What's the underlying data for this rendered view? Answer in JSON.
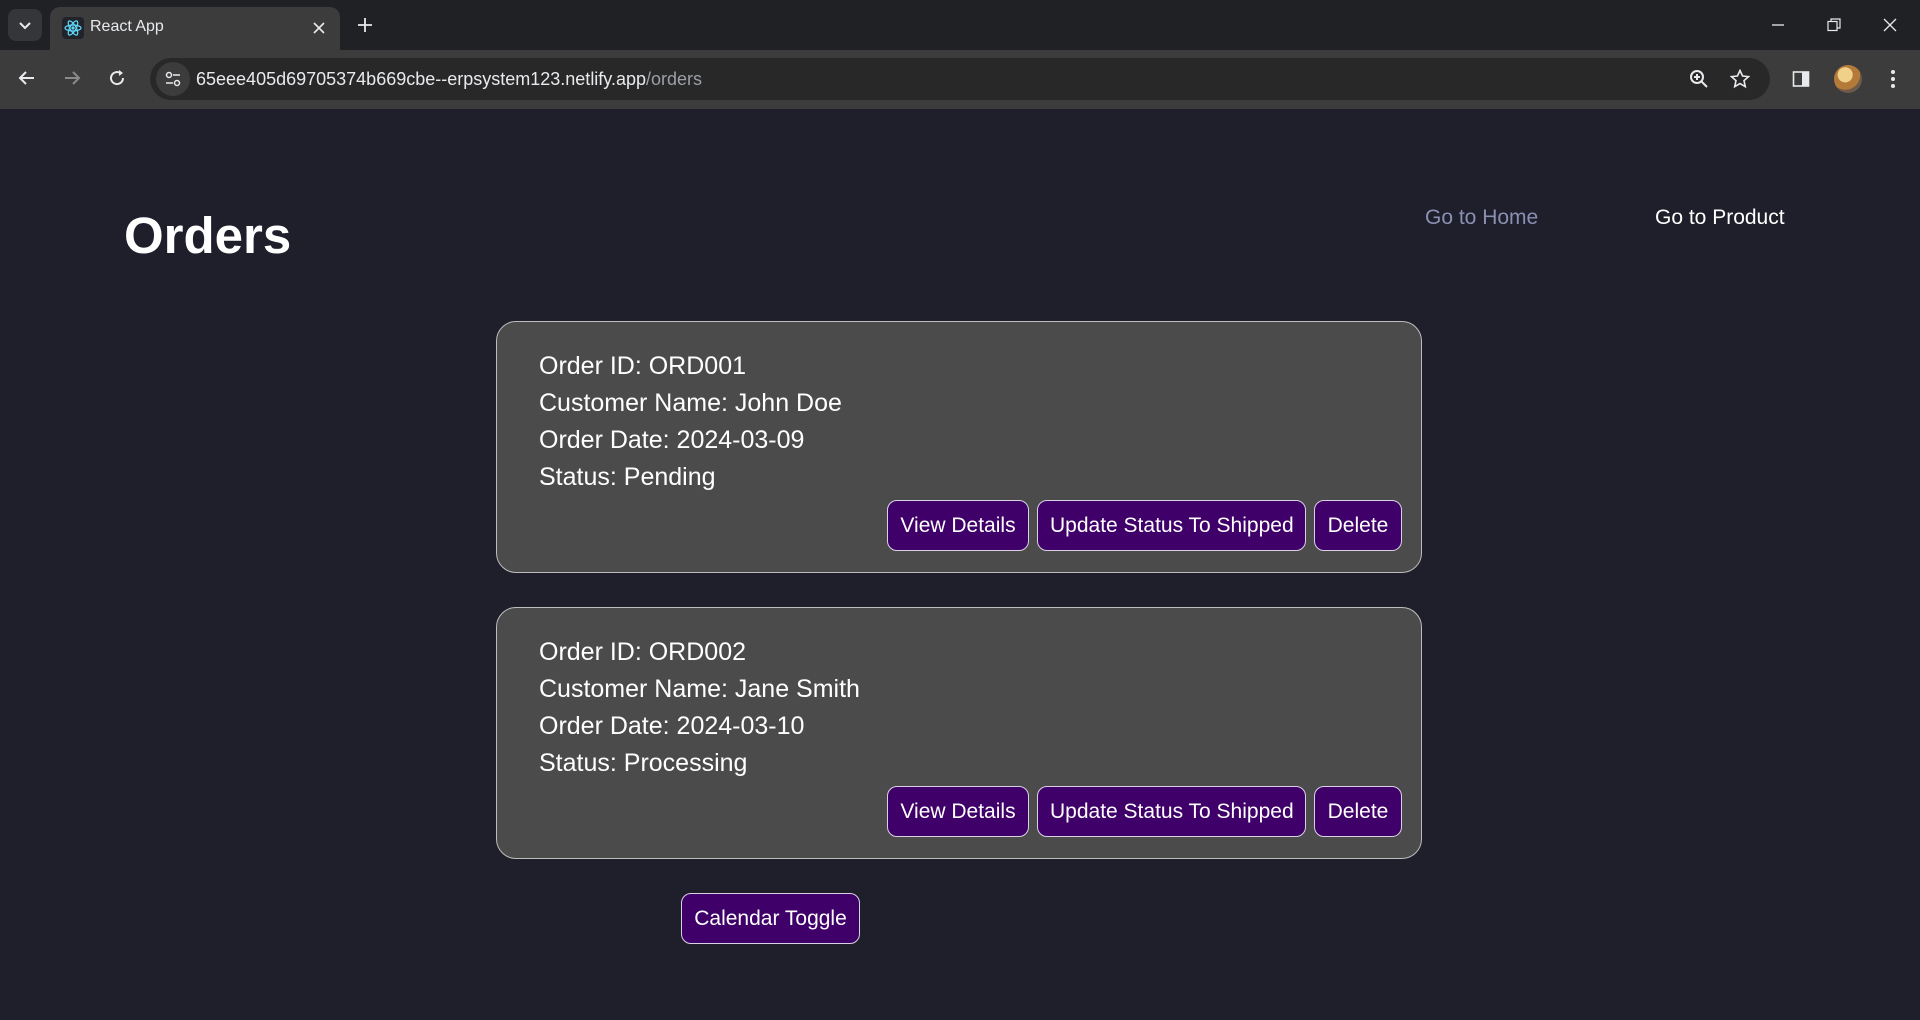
{
  "browser": {
    "tab_title": "React App",
    "url_host": "65eee405d69705374b669cbe--erpsystem123.netlify.app",
    "url_path": "/orders"
  },
  "page": {
    "title": "Orders",
    "nav": {
      "home_label": "Go to Home",
      "product_label": "Go to Product"
    }
  },
  "orders": [
    {
      "id_line": "Order ID: ORD001",
      "customer_line": "Customer Name: John Doe",
      "date_line": "Order Date: 2024-03-09",
      "status_line": "Status: Pending",
      "buttons": {
        "view": "View Details",
        "update": "Update Status To Shipped",
        "delete": "Delete"
      }
    },
    {
      "id_line": "Order ID: ORD002",
      "customer_line": "Customer Name: Jane Smith",
      "date_line": "Order Date: 2024-03-10",
      "status_line": "Status: Processing",
      "buttons": {
        "view": "View Details",
        "update": "Update Status To Shipped",
        "delete": "Delete"
      }
    }
  ],
  "calendar_toggle_label": "Calendar Toggle",
  "colors": {
    "page_background": "#1e1f2a",
    "card_background": "#4b4b4b",
    "button_background": "#3f0069",
    "nav_home_link": "#8b8fb4"
  },
  "icons": [
    "tab-search-icon",
    "react-favicon-icon",
    "close-icon",
    "plus-icon",
    "minimize-icon",
    "restore-icon",
    "back-arrow-icon",
    "forward-arrow-icon",
    "reload-icon",
    "site-info-icon",
    "zoom-icon",
    "star-icon",
    "side-panel-icon",
    "profile-avatar",
    "more-menu-icon"
  ]
}
